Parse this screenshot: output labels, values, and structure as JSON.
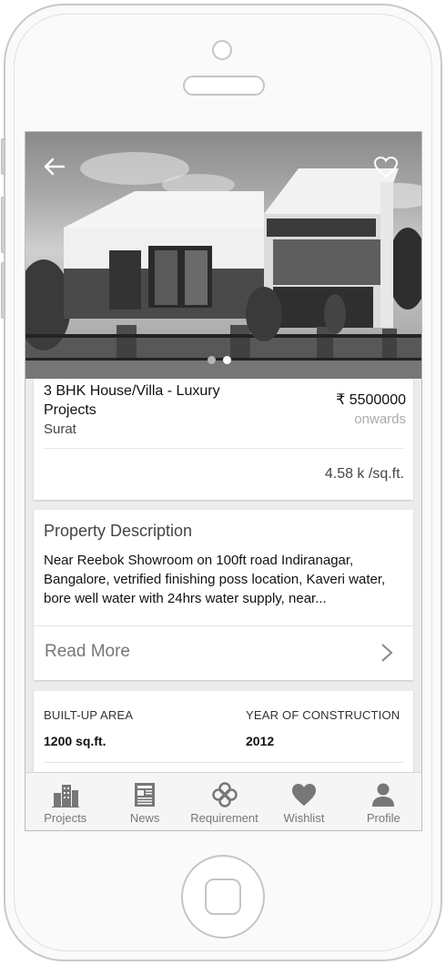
{
  "hero": {
    "back_icon": "arrow-left-icon",
    "favorite_icon": "heart-outline-icon",
    "carousel_pages": 2,
    "carousel_active": 2
  },
  "listing": {
    "title": "3 BHK House/Villa - Luxury Projects",
    "city": "Surat",
    "price": "₹ 5500000",
    "price_suffix": "onwards",
    "rate": "4.58 k /sq.ft."
  },
  "description": {
    "heading": "Property Description",
    "text": "Near Reebok Showroom on 100ft road Indiranagar, Bangalore, vetrified finishing poss location, Kaveri water, bore well water with 24hrs water supply, near...",
    "read_more_label": "Read More"
  },
  "specs": [
    {
      "label": "BUILT-UP AREA",
      "value": "1200 sq.ft."
    },
    {
      "label": "YEAR OF CONSTRUCTION",
      "value": "2012"
    }
  ],
  "bottom_nav": [
    {
      "label": "Projects",
      "icon": "buildings-icon"
    },
    {
      "label": "News",
      "icon": "newspaper-icon"
    },
    {
      "label": "Requirement",
      "icon": "requirement-icon"
    },
    {
      "label": "Wishlist",
      "icon": "heart-icon"
    },
    {
      "label": "Profile",
      "icon": "person-icon"
    }
  ]
}
